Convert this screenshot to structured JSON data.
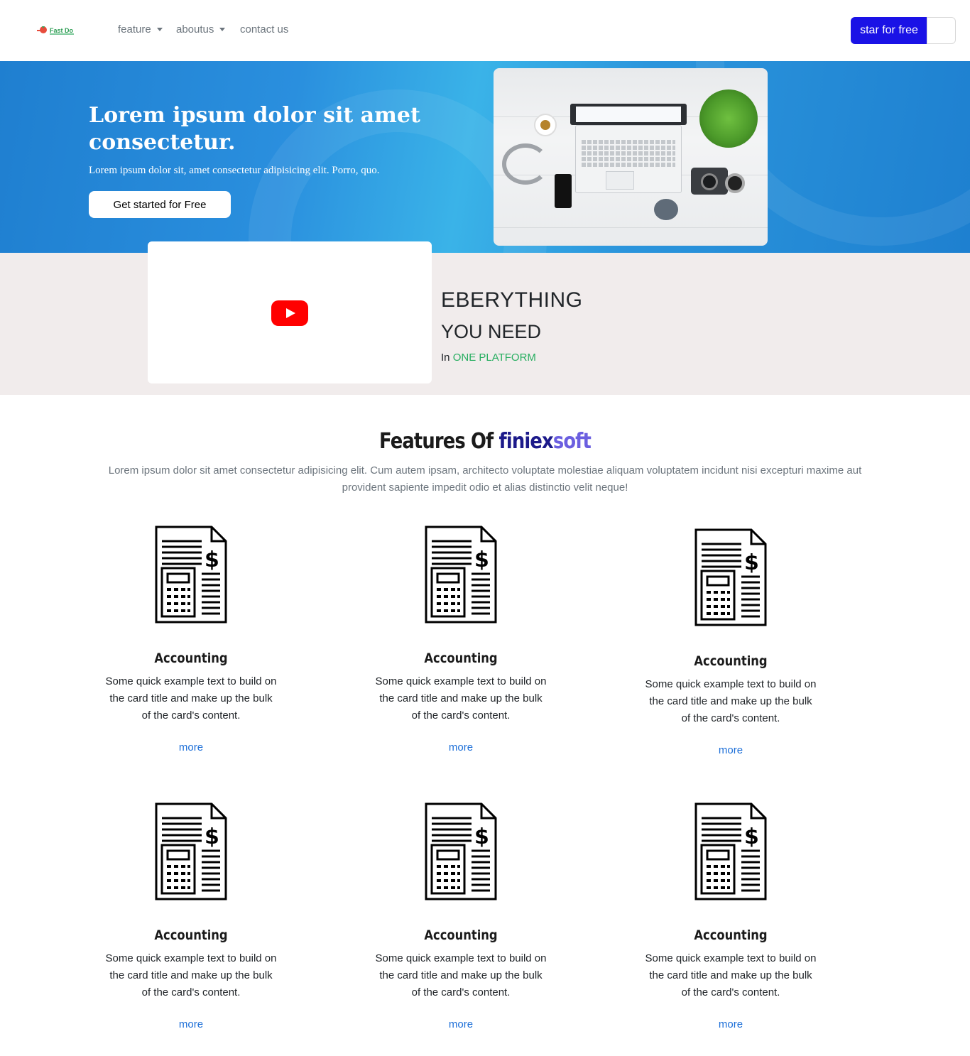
{
  "navbar": {
    "logo_text": "Fast Do",
    "items": [
      {
        "label": "feature",
        "dropdown": true
      },
      {
        "label": "aboutus",
        "dropdown": true
      },
      {
        "label": "contact us",
        "dropdown": false
      }
    ],
    "cta_label": "star for free",
    "cta_color": "#1a12e6"
  },
  "hero": {
    "title": "Lorem ipsum dolor sit amet consectetur.",
    "subtitle": "Lorem ipsum dolor sit, amet consectetur adipisicing elit. Porro, quo.",
    "button_label": "Get started for Free"
  },
  "promo": {
    "line1": "EBERYTHING",
    "line2": "YOU NEED",
    "line3_prefix": "In ",
    "line3_highlight": "ONE PLATFORM"
  },
  "features": {
    "title_prefix": "Features Of ",
    "title_brand_a": "finiex",
    "title_brand_b": "soft",
    "description": "Lorem ipsum dolor sit amet consectetur adipisicing elit. Cum autem ipsam, architecto voluptate molestiae aliquam voluptatem incidunt nisi excepturi maxime aut provident sapiente impedit odio et alias distinctio velit neque!",
    "cards": [
      {
        "icon": "accounting-invoice-icon",
        "title": "Accounting",
        "text": "Some quick example text to build on the card title and make up the bulk of the card's content.",
        "link": "more"
      },
      {
        "icon": "accounting-invoice-icon",
        "title": "Accounting",
        "text": "Some quick example text to build on the card title and make up the bulk of the card's content.",
        "link": "more"
      },
      {
        "icon": "accounting-invoice-icon",
        "title": "Accounting",
        "text": "Some quick example text to build on the card title and make up the bulk of the card's content.",
        "link": "more"
      },
      {
        "icon": "accounting-invoice-icon",
        "title": "Accounting",
        "text": "Some quick example text to build on the card title and make up the bulk of the card's content.",
        "link": "more"
      },
      {
        "icon": "accounting-invoice-icon",
        "title": "Accounting",
        "text": "Some quick example text to build on the card title and make up the bulk of the card's content.",
        "link": "more"
      },
      {
        "icon": "accounting-invoice-icon",
        "title": "Accounting",
        "text": "Some quick example text to build on the card title and make up the bulk of the card's content.",
        "link": "more"
      }
    ]
  }
}
